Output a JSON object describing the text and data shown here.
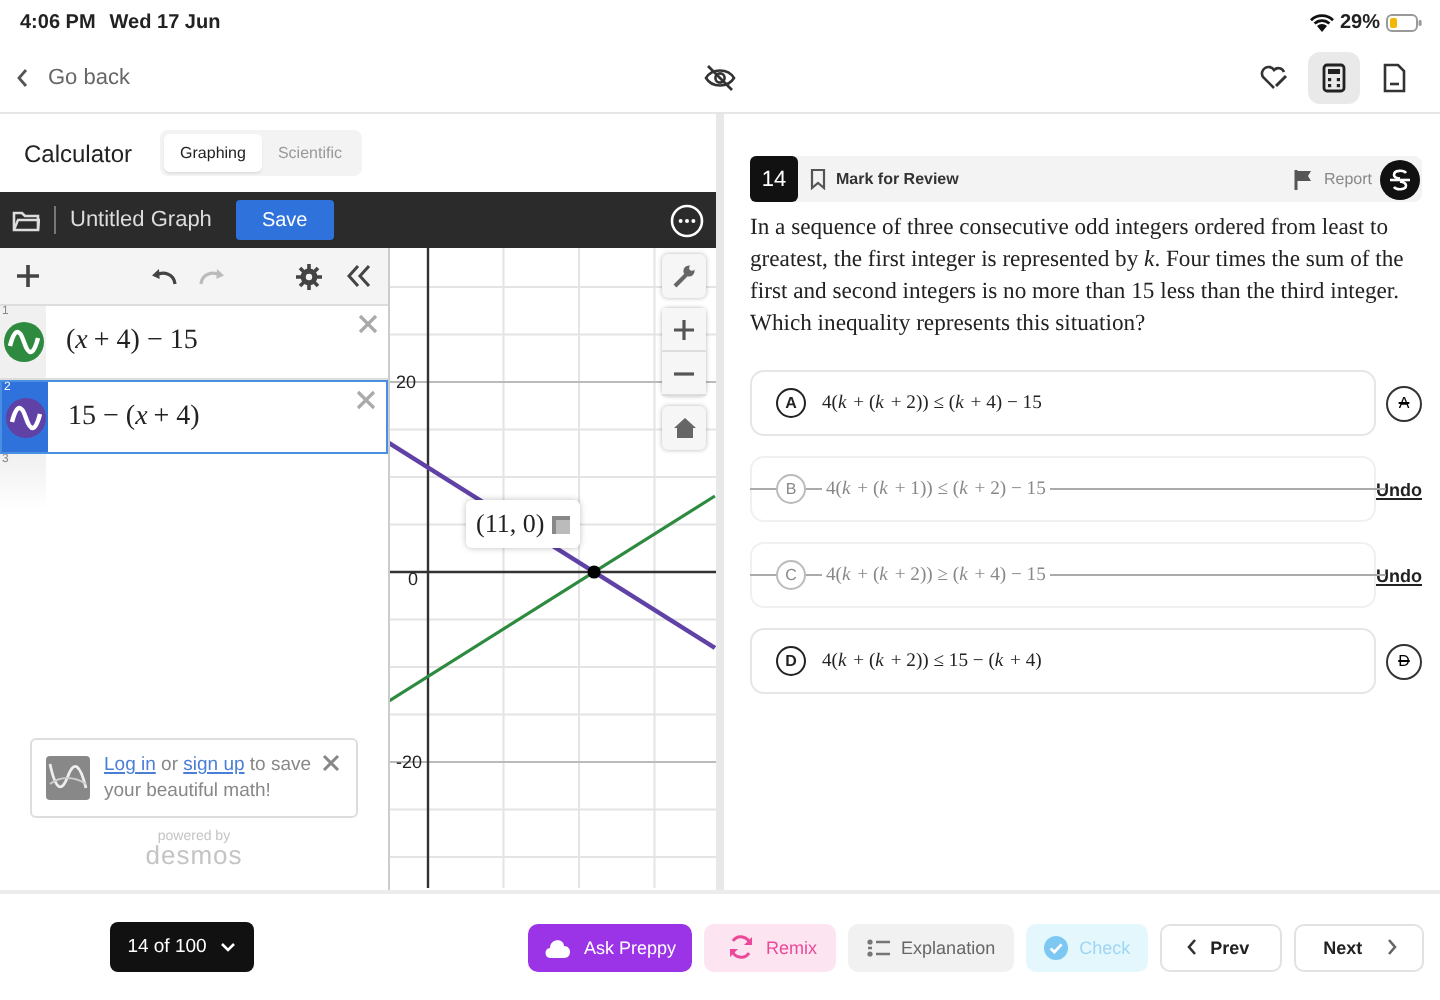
{
  "status_bar": {
    "time": "4:06 PM",
    "date": "Wed 17 Jun",
    "battery": "29%"
  },
  "header": {
    "back": "Go back",
    "tools": [
      {
        "selected": false
      },
      {
        "selected": true
      },
      {
        "selected": false
      }
    ]
  },
  "calculator": {
    "title": "Calculator",
    "modes": [
      {
        "label": "Graphing",
        "selected": true
      },
      {
        "label": "Scientific",
        "selected": false
      }
    ],
    "graph_title": "Untitled Graph",
    "save": "Save",
    "expressions": [
      {
        "number": "1",
        "latex": "(*x* + 4) − 15",
        "color": "#2d8a3e",
        "selected": false
      },
      {
        "number": "2",
        "latex": "15 − (*x* + 4)",
        "color": "#6042a6",
        "selected": true
      }
    ],
    "empty_row": "3",
    "notice": {
      "login": "Log in",
      "or": " or ",
      "signup": "sign up",
      "rest": " to save your beautiful math!"
    },
    "powered_by": "powered by",
    "brand": "desmos",
    "graph": {
      "y_labels": [
        "20",
        "0",
        "-20"
      ],
      "point_label": "(11, 0)"
    }
  },
  "question": {
    "number": "14",
    "mark": "Mark for Review",
    "report": "Report",
    "text": "In a sequence of three consecutive odd integers ordered from least to greatest, the first integer is represented by *k*. Four times the sum of the first and second integers is no more than 15 less than the third integer. Which inequality represents this situation?",
    "choices": [
      {
        "letter": "A",
        "text": "4(*k* + (*k* + 2)) ≤ (*k* + 4) − 15",
        "eliminated": false,
        "eliminate_label": "A"
      },
      {
        "letter": "B",
        "text": "4(*k* + (*k* + 1)) ≤ (*k* + 2) − 15",
        "eliminated": true,
        "undo": "Undo"
      },
      {
        "letter": "C",
        "text": "4(*k* + (*k* + 2)) ≥ (*k* + 4) − 15",
        "eliminated": true,
        "undo": "Undo"
      },
      {
        "letter": "D",
        "text": "4(*k* + (*k* + 2)) ≤ 15 − (*k* + 4)",
        "eliminated": false,
        "eliminate_label": "D"
      }
    ]
  },
  "footer": {
    "progress": "14 of 100",
    "buttons": [
      {
        "kind": "ask",
        "label": "Ask Preppy",
        "disabled": false
      },
      {
        "kind": "remix",
        "label": "Remix",
        "disabled": false
      },
      {
        "kind": "explanation",
        "label": "Explanation",
        "disabled": false
      },
      {
        "kind": "check",
        "label": "Check",
        "disabled": true
      },
      {
        "kind": "prev",
        "label": "Prev",
        "disabled": false
      },
      {
        "kind": "next",
        "label": "Next",
        "disabled": false
      }
    ]
  }
}
